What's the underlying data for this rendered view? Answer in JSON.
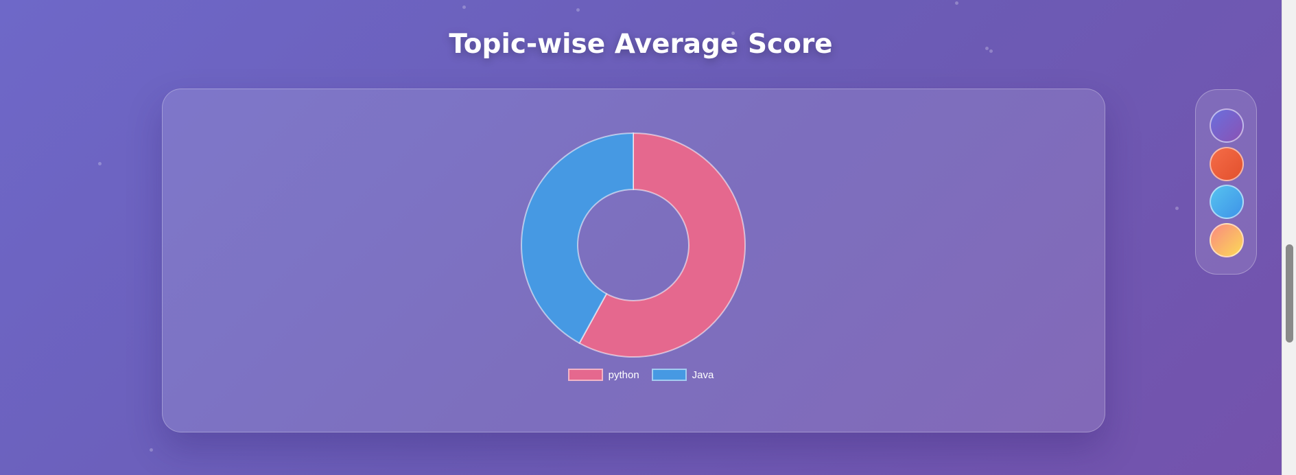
{
  "page": {
    "title": "Topic-wise Average Score"
  },
  "chart_data": {
    "type": "pie",
    "variant": "doughnut",
    "title": "",
    "categories": [
      "python",
      "Java"
    ],
    "values": [
      58,
      42
    ],
    "colors": [
      "#e5688e",
      "#4699e3"
    ],
    "legend": {
      "placement": "bottom",
      "entries": [
        "python",
        "Java"
      ]
    }
  },
  "theme_picker": {
    "options": [
      {
        "name": "purple-blue",
        "colors": [
          "#6a6fdd",
          "#8a52b4"
        ]
      },
      {
        "name": "orange-red",
        "colors": [
          "#f56c48",
          "#e2502d"
        ]
      },
      {
        "name": "sky-blue",
        "colors": [
          "#56c2ef",
          "#3e93e8"
        ]
      },
      {
        "name": "peach-yellow",
        "colors": [
          "#f98a7f",
          "#fcd957"
        ]
      }
    ]
  }
}
